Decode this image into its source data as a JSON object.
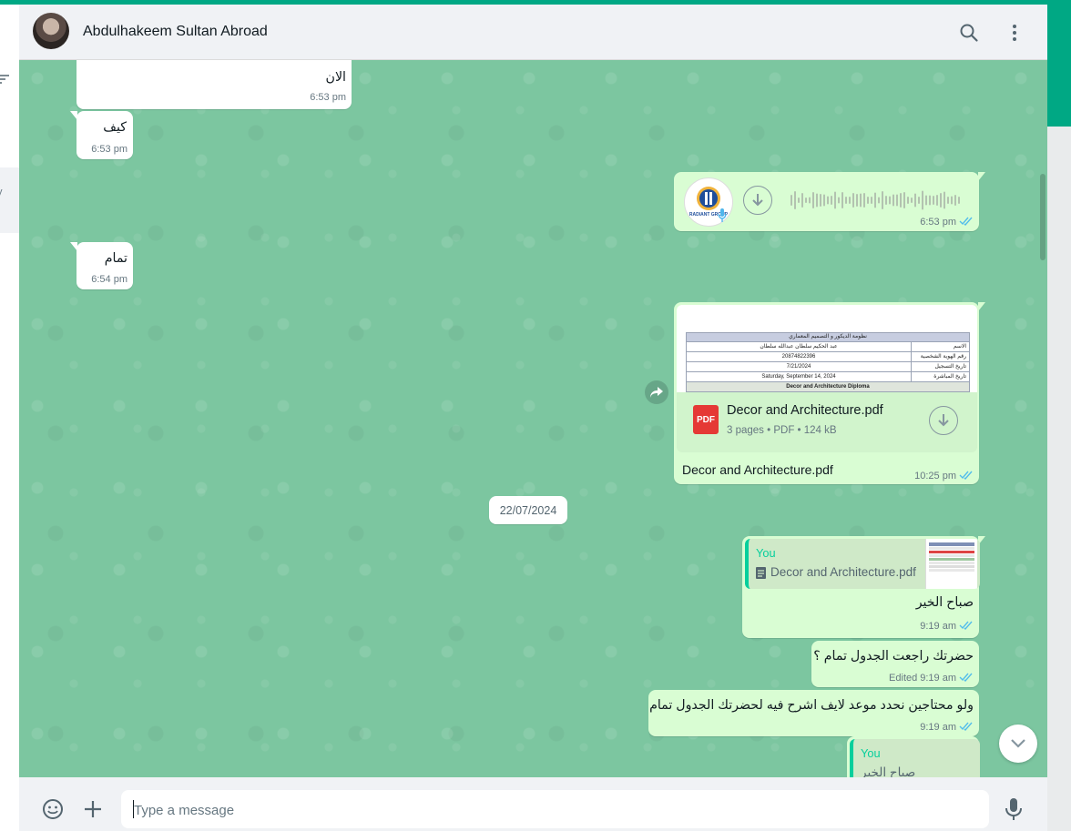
{
  "header": {
    "contact_name": "Abdulhakeem Sultan Abroad"
  },
  "messages": [
    {
      "text": "الان",
      "time": "6:53 pm"
    },
    {
      "text": "كيف",
      "time": "6:53 pm"
    },
    {
      "voice_time": "6:53 pm",
      "voice_avatar_label": "RADIANT GROUP"
    },
    {
      "text": "تمام",
      "time": "6:54 pm"
    },
    {
      "doc_title": "Decor and Architecture.pdf",
      "doc_meta": "3 pages • PDF • 124 kB",
      "doc_badge": "PDF",
      "caption": "Decor and Architecture.pdf",
      "time": "10:25 pm",
      "preview": {
        "heading": "نظومة الديكور و التصميم المعماري",
        "rows": [
          {
            "label": "الاسم",
            "value": "عبد الحكيم سلطان عبدالله سلطان"
          },
          {
            "label": "رقم الهوية الشخصية",
            "value": "20874822396"
          },
          {
            "label": "تاريخ التسجيل",
            "value": "7/21/2024"
          },
          {
            "label": "تاريخ المباشرة",
            "value": "Saturday, September 14, 2024"
          }
        ],
        "section": "Decor and Architecture Diploma"
      }
    },
    {
      "quote_name": "You",
      "quote_text": "Decor and Architecture.pdf",
      "text": "صباح الخير",
      "time": "9:19 am"
    },
    {
      "text": "حضرتك راجعت الجدول تمام ؟",
      "edited": "Edited",
      "time": "9:19 am"
    },
    {
      "text": "ولو محتاجين نحدد موعد لايف اشرح فيه لحضرتك الجدول تمام",
      "time": "9:19 am"
    },
    {
      "quote_name": "You",
      "quote_text": "صباح الخير"
    }
  ],
  "date_chip": "22/07/2024",
  "composer": {
    "placeholder": "Type a message"
  },
  "left_panel": {
    "snippet": "y"
  }
}
